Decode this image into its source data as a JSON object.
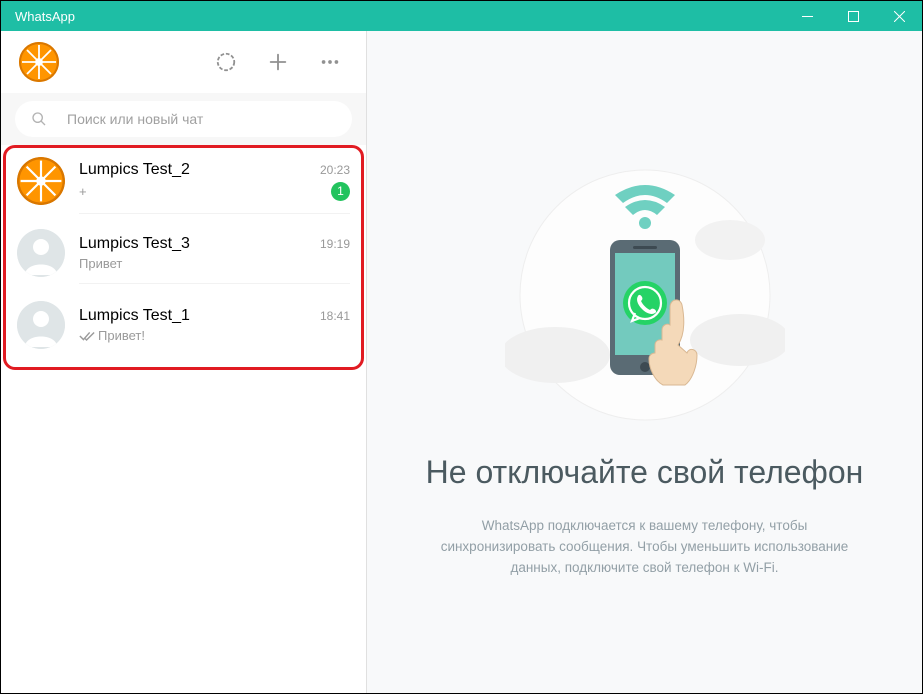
{
  "window": {
    "title": "WhatsApp"
  },
  "search": {
    "placeholder": "Поиск или новый чат"
  },
  "chats": [
    {
      "name": "Lumpics Test_2",
      "time": "20:23",
      "msg": "+",
      "unread": "1",
      "avatar": "orange",
      "ticks": false
    },
    {
      "name": "Lumpics Test_3",
      "time": "19:19",
      "msg": "Привет",
      "unread": null,
      "avatar": "default",
      "ticks": false
    },
    {
      "name": "Lumpics Test_1",
      "time": "18:41",
      "msg": "Привет!",
      "unread": null,
      "avatar": "default",
      "ticks": true
    }
  ],
  "intro": {
    "title": "Не отключайте свой телефон",
    "subtitle": "WhatsApp подключается к вашему телефону, чтобы синхронизировать сообщения. Чтобы уменьшить использование данных, подключите свой телефон к Wi-Fi."
  }
}
